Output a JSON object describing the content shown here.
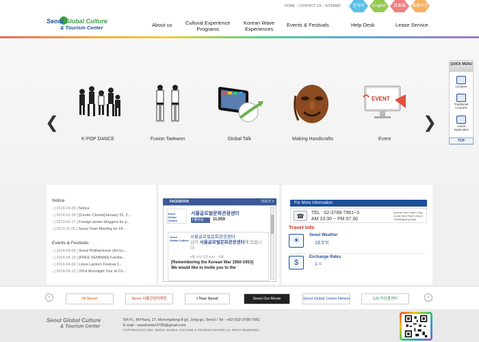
{
  "toplinks": [
    "HOME",
    "CONTACT US",
    "SITEMAP"
  ],
  "languages": [
    "한국어",
    "English",
    "日本語",
    "简体中文"
  ],
  "logo": {
    "line1a": "Seoul ",
    "line1b": "Global Culture",
    "line2": "& Tourism Center"
  },
  "nav": [
    {
      "label": "About us"
    },
    {
      "label": "Cultural Experience\nPrograms"
    },
    {
      "label": "Korean Wave\nExperiences"
    },
    {
      "label": "Events & Festivals"
    },
    {
      "label": "Help Desk"
    },
    {
      "label": "Lease Service"
    }
  ],
  "slides": [
    {
      "caption": "K-POP DANCE"
    },
    {
      "caption": "Fusion Taekwon"
    },
    {
      "caption": "Global Talk"
    },
    {
      "caption": "Making Handicrafts"
    },
    {
      "caption": "Event"
    }
  ],
  "event_screen_text": "EVENT",
  "quick_menu": {
    "title": "QUICK MENU",
    "items": [
      "Location",
      "Traditional Costume",
      "Lease Application"
    ],
    "top": "TOP"
  },
  "notice": {
    "title": "Notice",
    "items": [
      {
        "date": "[ 2014-03-05 ]",
        "text": "Notice"
      },
      {
        "date": "[ 2014-01-29 ]",
        "text": "[Center Closed]January 31, 2..."
      },
      {
        "date": "[ 2013-01-17 ]",
        "text": "Foreign power bloggers for p..."
      },
      {
        "date": "[ 2013-11-25 ]",
        "text": "Seoul Town Meeting for Fil..."
      }
    ]
  },
  "events": {
    "title": "Events & Festivals",
    "items": [
      {
        "date": "[ 2014-06-05 ]",
        "text": "Seoul Philharmonic (An Ev..."
      },
      {
        "date": "[ 2014-04-15 ]",
        "text": "[FREE SEMINAR] Familie..."
      },
      {
        "date": "[ 2014-04-04 ]",
        "text": "Lotus Lantern Festival 2..."
      },
      {
        "date": "[ 2014-03-13 ]",
        "text": "2014 Moonlight Tour at Ch..."
      }
    ]
  },
  "facebook": {
    "header": "FACEBOOK",
    "more": "더보기 >",
    "page_name": "서울글로벌문화관광센터",
    "like": "좋아요",
    "likes_count": "11,959",
    "post_author": "서울글로벌문화관광센터",
    "post_action": "님이 ",
    "post_target": "서울글로벌문화관광센터",
    "post_suffix": "에 있습니다.",
    "post_date": "6월 12일 오전 9:01 · 서울",
    "post_body": "[Remembering the Korean War 1950-1953]\nWe would like to invite you to the"
  },
  "info": {
    "header": "For More Information",
    "tel": "TEL : 02-3789-7961~3",
    "hours": "AM 10:30 ~ PM 07:30",
    "note": "(except New Year's Day, Lunar New Year's Day & Thanksgiving Day)",
    "travel_title": "Travel Info",
    "weather_label": "Seoul Weather",
    "weather_value": "19.5℃",
    "rates_label": "Exchange Rates",
    "rates_value": "1 ="
  },
  "banners": [
    "HI Seoul",
    "Seoul 서울관광마케팅",
    "i Tour Seoul",
    "Seoul Our Movie",
    "Seoul Global Center Network",
    "120 다산콜센터"
  ],
  "footer": {
    "logo_a": "Seoul Global Culture",
    "logo_b": "& Tourism Center",
    "address": "5th FL, M-Plaza, 27, Myeongdong 8-gil, Jung-gu, Seoul / Tel : +82-(0)2-3789-7961",
    "email": "E-mail : seoulcenter3789@gmail.com",
    "copyright": "COPYRIGHT(C) 2011. SEOUL GLOBAL CULTURE & TOURISM CENTER ALL RIGHT RESERVED."
  }
}
